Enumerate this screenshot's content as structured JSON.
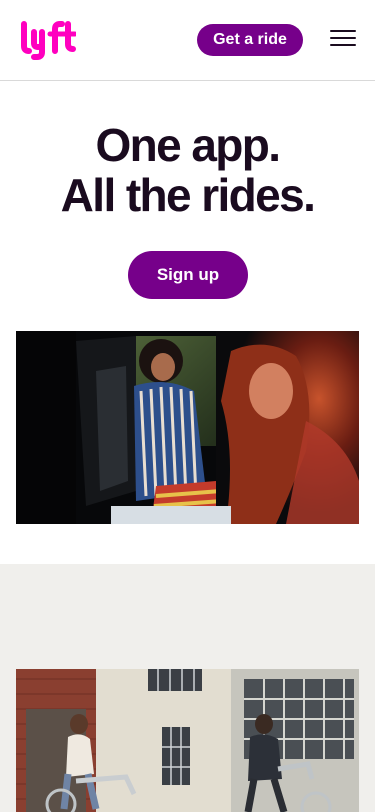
{
  "brand": {
    "name": "lyft",
    "accent": "#ff00bf",
    "primary": "#76008a",
    "text": "#1a0b1f"
  },
  "header": {
    "logo_icon": "lyft-logo",
    "ride_label": "Get a ride",
    "menu_icon": "hamburger-menu-icon"
  },
  "hero": {
    "title_line1": "One app.",
    "title_line2": "All the rides.",
    "signup_label": "Sign up"
  },
  "images": {
    "hero_photo": "photo of two women getting into a car at night",
    "bike_photo": "photo of two people riding bikes past a building"
  }
}
